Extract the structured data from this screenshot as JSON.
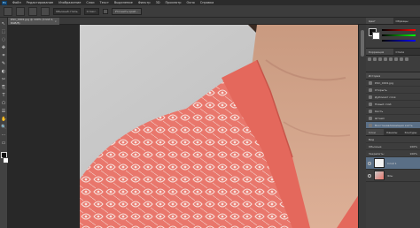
{
  "app": {
    "logo_text": "Ps",
    "menus": [
      "Файл",
      "Редактирование",
      "Изображение",
      "Слои",
      "Текст",
      "Выделение",
      "Фильтр",
      "3D",
      "Просмотр",
      "Окно",
      "Справка"
    ]
  },
  "options_bar": {
    "field1": "Обычный стиль",
    "field2": "0 пикс.",
    "button": "Уточнить край..."
  },
  "document": {
    "tab_label": "DSC_0001.jpg @ 100% (Слой 1, RGB/8)",
    "close_glyph": "×"
  },
  "toolbar": {
    "tools": [
      "↖",
      "⬚",
      "◌",
      "✥",
      "⌗",
      "✎",
      "◐",
      "✂",
      "⎘",
      "T",
      "⬠",
      "☰",
      "✋",
      "🔍",
      "⋯",
      "▭"
    ]
  },
  "panels": {
    "top_tabs": [
      "Цвет",
      "Образцы"
    ],
    "adjust_tabs": [
      "Коррекция",
      "Стили"
    ],
    "history_tab": "История",
    "history_items": [
      "DSC_0001.jpg",
      "Открыть",
      "Дубликат слоя",
      "Новый слой",
      "Кисть",
      "Штамп",
      "Восстанавливающая кисть"
    ],
    "layers_tabs": [
      "Слои",
      "Каналы",
      "Контуры"
    ],
    "layers_kind": "Вид",
    "layers_blend": "Обычные",
    "layers_opacity": "100%",
    "layers_lock": "Закрепить:",
    "layers_fill": "100%",
    "layers": [
      "Слой 1",
      "Фон"
    ]
  },
  "colors": {
    "menubar": "#2b2b2b",
    "panel": "#3d3d3d",
    "selection": "#5a6f86",
    "shirt": "#e9776c",
    "skin": "#d9a58b",
    "wall": "#c8c8c8"
  }
}
